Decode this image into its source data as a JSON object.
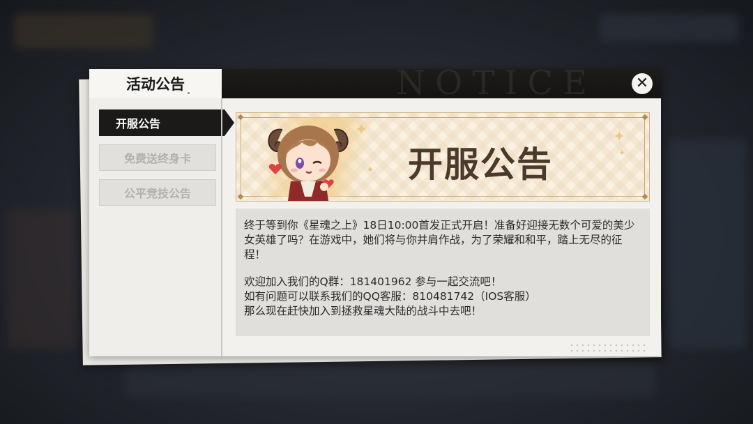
{
  "dialog": {
    "title": "活动公告",
    "header_watermark": "NOTICE",
    "close_label": "✕"
  },
  "sidebar": {
    "items": [
      {
        "label": "开服公告",
        "active": true
      },
      {
        "label": "免费送终身卡",
        "active": false
      },
      {
        "label": "公平竞技公告",
        "active": false
      }
    ]
  },
  "banner": {
    "title": "开服公告"
  },
  "content": {
    "paragraph_1": "终于等到你《星魂之上》18日10:00首发正式开启！准备好迎接无数个可爱的美少女英雄了吗？在游戏中，她们将与你并肩作战，为了荣耀和和平，踏上无尽的征程！",
    "line_qq_group": "欢迎加入我们的Q群：181401962 参与一起交流吧！",
    "line_support": "如有问题可以联系我们的QQ客服：810481742（IOS客服）",
    "line_cta": "那么现在赶快加入到拯救星魂大陆的战斗中去吧！"
  },
  "colors": {
    "header_dark": "#1b1a19",
    "banner_text": "#4b3a2c",
    "banner_bg": "#fbf1e1",
    "content_bg": "#e0dfdc"
  },
  "icons": {
    "close": "close-icon",
    "character": "chibi-character-icon"
  }
}
